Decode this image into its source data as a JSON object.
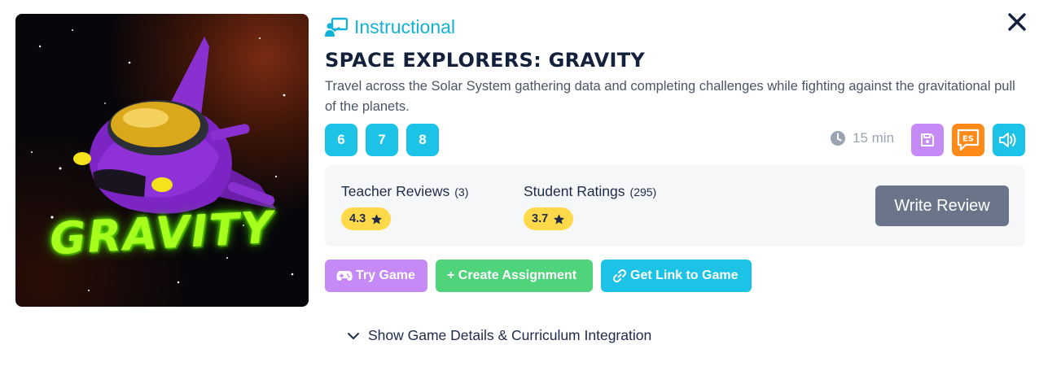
{
  "thumbnail": {
    "title_art": "GRAVITY"
  },
  "category": {
    "label": "Instructional",
    "icon": "teacher-board-icon",
    "color": "#12b3d6"
  },
  "close": {
    "icon": "close-icon"
  },
  "game": {
    "title": "SPACE EXPLORERS: GRAVITY",
    "description": "Travel across the Solar System gathering data and completing challenges while fighting against the gravitational pull of the planets."
  },
  "grades": [
    "6",
    "7",
    "8"
  ],
  "duration": {
    "icon": "clock-icon",
    "label": "15 min"
  },
  "icon_buttons": {
    "save": {
      "icon": "save-icon",
      "color": "#c58af5"
    },
    "spanish": {
      "icon": "es-speech-icon",
      "label": "ES",
      "color": "#ff8a1a"
    },
    "audio": {
      "icon": "speaker-icon",
      "color": "#1cc3e6"
    }
  },
  "reviews": {
    "teacher": {
      "label": "Teacher Reviews",
      "count": "(3)",
      "rating": "4.3"
    },
    "student": {
      "label": "Student Ratings",
      "count": "(295)",
      "rating": "3.7"
    },
    "write_button": "Write Review"
  },
  "actions": {
    "try": {
      "label": "Try Game",
      "icon": "gamepad-icon"
    },
    "create": {
      "label": "+ Create Assignment"
    },
    "link": {
      "label": "Get Link to Game",
      "icon": "link-icon"
    }
  },
  "details_toggle": {
    "label": "Show Game Details & Curriculum Integration",
    "icon": "chevron-down-icon"
  }
}
